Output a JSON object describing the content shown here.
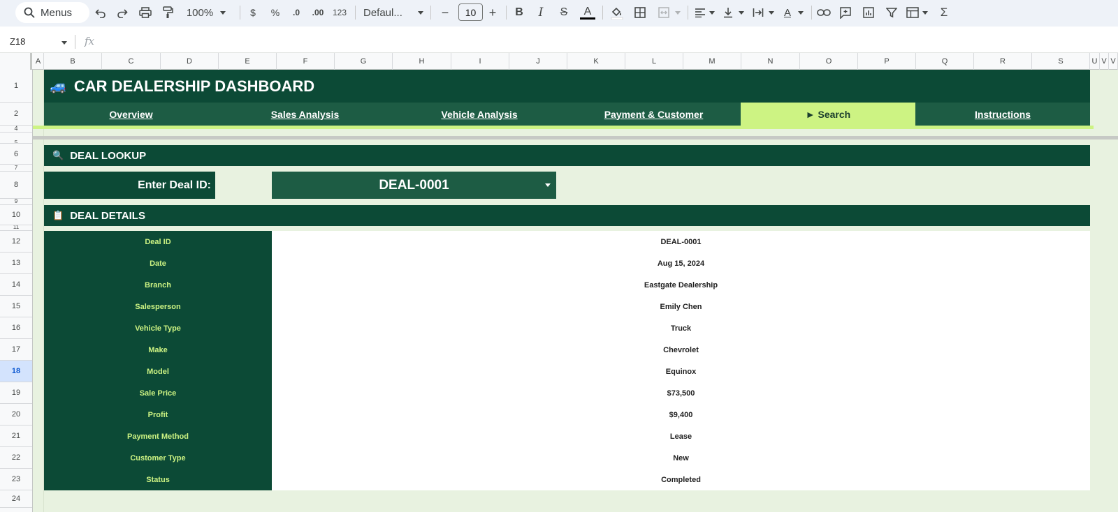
{
  "toolbar": {
    "search_label": "Menus",
    "zoom": "100%",
    "currency": "$",
    "percent": "%",
    "decrease_decimals": ".0",
    "increase_decimals": ".00",
    "number_format": "123",
    "font_family": "Defaul...",
    "font_size": "10",
    "minus": "−",
    "plus": "+",
    "bold": "B",
    "italic": "I",
    "strikethrough": "S",
    "text_color": "A",
    "text_rotation": "A",
    "functions": "Σ"
  },
  "formula_bar": {
    "cell_ref": "Z18",
    "fx": "fx"
  },
  "grid": {
    "columns": [
      "A",
      "B",
      "C",
      "D",
      "E",
      "F",
      "G",
      "H",
      "I",
      "J",
      "K",
      "L",
      "M",
      "N",
      "O",
      "P",
      "Q",
      "R",
      "S",
      "U",
      "V",
      "V"
    ],
    "rows": [
      "1",
      "2",
      "4",
      "5",
      "6",
      "7",
      "8",
      "9",
      "10",
      "11",
      "12",
      "13",
      "14",
      "15",
      "16",
      "17",
      "18",
      "19",
      "20",
      "21",
      "22",
      "23",
      "24"
    ],
    "active_row": "18"
  },
  "dashboard": {
    "title_icon": "🚙",
    "title": "CAR DEALERSHIP DASHBOARD",
    "nav": [
      {
        "label": "Overview"
      },
      {
        "label": "Sales Analysis"
      },
      {
        "label": "Vehicle Analysis"
      },
      {
        "label": "Payment & Customer"
      },
      {
        "label": "► Search"
      },
      {
        "label": "Instructions"
      }
    ],
    "lookup_section": {
      "icon": "🔍",
      "title": "DEAL LOOKUP"
    },
    "lookup_label": "Enter Deal ID:",
    "lookup_value": "DEAL-0001",
    "details_section": {
      "icon": "📋",
      "title": "DEAL DETAILS"
    },
    "details": [
      {
        "label": "Deal ID",
        "value": "DEAL-0001"
      },
      {
        "label": "Date",
        "value": "Aug 15, 2024"
      },
      {
        "label": "Branch",
        "value": "Eastgate Dealership"
      },
      {
        "label": "Salesperson",
        "value": "Emily Chen"
      },
      {
        "label": "Vehicle Type",
        "value": "Truck"
      },
      {
        "label": "Make",
        "value": "Chevrolet"
      },
      {
        "label": "Model",
        "value": "Equinox"
      },
      {
        "label": "Sale Price",
        "value": "$73,500"
      },
      {
        "label": "Profit",
        "value": "$9,400"
      },
      {
        "label": "Payment Method",
        "value": "Lease"
      },
      {
        "label": "Customer Type",
        "value": "New"
      },
      {
        "label": "Status",
        "value": "Completed"
      }
    ]
  },
  "colors": {
    "dark_green": "#0c4a36",
    "mid_green": "#1d5c44",
    "lime": "#cdf383",
    "sheet_bg": "#e8f2e0"
  }
}
